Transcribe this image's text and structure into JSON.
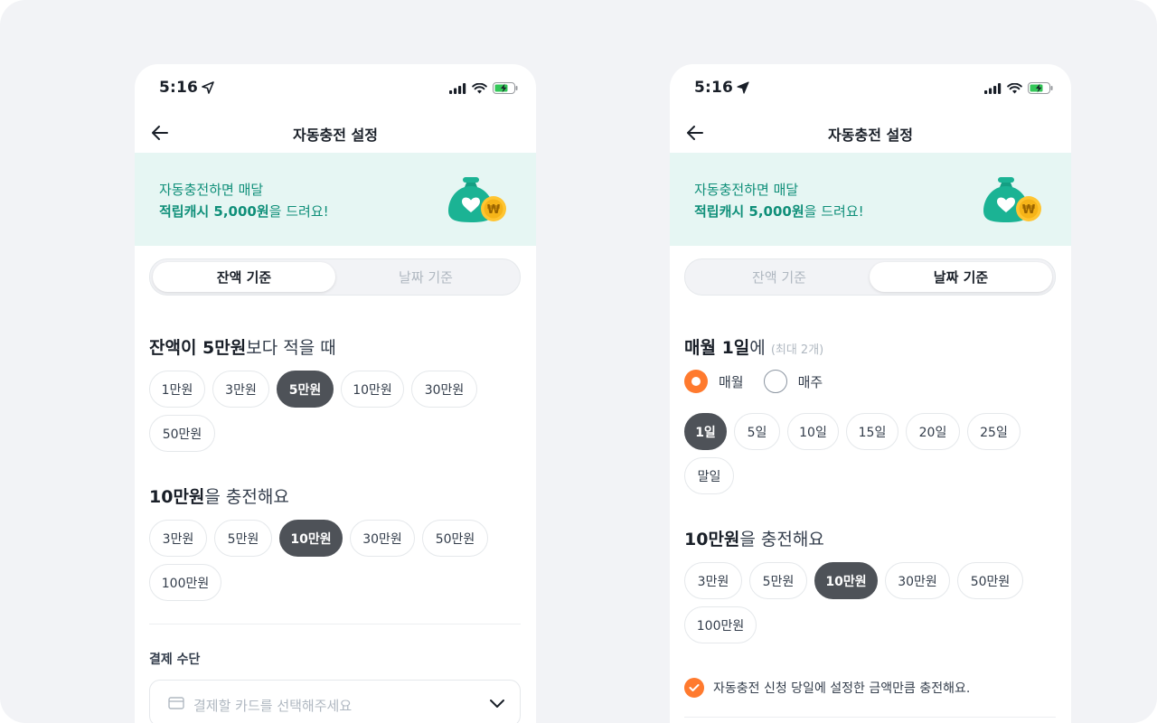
{
  "status": {
    "time": "5:16"
  },
  "header": {
    "title": "자동충전 설정"
  },
  "banner": {
    "line1": "자동충전하면 매달",
    "line2_bold": "적립캐시 5,000원",
    "line2_rest": "을 드려요!",
    "coin_symbol": "₩"
  },
  "tabs": {
    "balance": "잔액 기준",
    "date": "날짜 기준"
  },
  "left": {
    "threshold_bold": "잔액이 5만원",
    "threshold_rest": "보다 적을 때",
    "threshold_options": [
      "1만원",
      "3만원",
      "5만원",
      "10만원",
      "30만원",
      "50만원"
    ],
    "threshold_selected": "5만원",
    "charge_bold": "10만원",
    "charge_rest": "을 충전해요",
    "charge_options": [
      "3만원",
      "5만원",
      "10만원",
      "30만원",
      "50만원",
      "100만원"
    ],
    "charge_selected": "10만원",
    "payment_label": "결제 수단",
    "payment_placeholder": "결제할 카드를 선택해주세요"
  },
  "right": {
    "date_bold": "매월 1일",
    "date_rest": "에",
    "date_hint": "(최대 2개)",
    "period_options": [
      "매월",
      "매주"
    ],
    "period_selected": "매월",
    "day_options": [
      "1일",
      "5일",
      "10일",
      "15일",
      "20일",
      "25일",
      "말일"
    ],
    "day_selected": "1일",
    "charge_bold": "10만원",
    "charge_rest": "을 충전해요",
    "charge_options": [
      "3만원",
      "5만원",
      "10만원",
      "30만원",
      "50만원",
      "100만원"
    ],
    "charge_selected": "10만원",
    "notice": "자동충전 신청 당일에 설정한 금액만큼 충전해요."
  },
  "colors": {
    "accent": "#ff7a2e",
    "banner_bg": "#e6f6f3",
    "banner_text": "#0f8f79",
    "chip_selected": "#4e5258",
    "money_bag": "#1bb394",
    "coin": "#ffc531"
  }
}
